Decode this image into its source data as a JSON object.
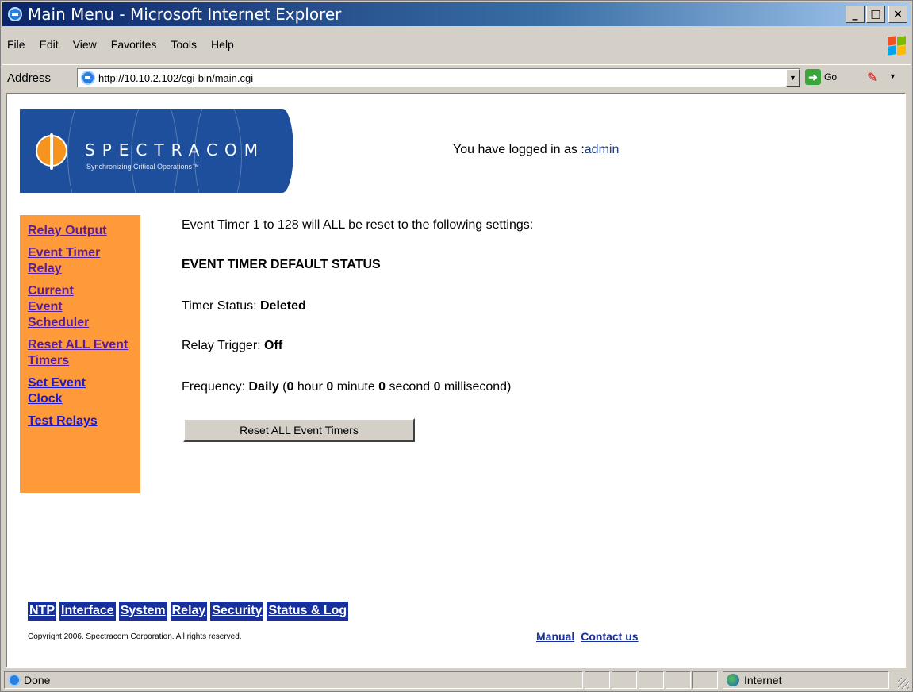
{
  "window": {
    "title": "Main Menu - Microsoft Internet Explorer",
    "minimize": "_",
    "maximize": "□",
    "close": "×"
  },
  "menubar": {
    "items": [
      "File",
      "Edit",
      "View",
      "Favorites",
      "Tools",
      "Help"
    ]
  },
  "addressbar": {
    "label": "Address",
    "url": "http://10.10.2.102/cgi-bin/main.cgi",
    "go_label": "Go"
  },
  "header": {
    "logo_name": "SPECTRACOM",
    "logo_tagline": "Synchronizing Critical Operations™",
    "login_prefix": "You have logged in as :",
    "login_user": "admin"
  },
  "sidemenu": {
    "items": [
      "Relay Output",
      "Event Timer Relay",
      "Current Event Scheduler",
      "Reset ALL Event Timers",
      "Set Event Clock",
      "Test Relays"
    ]
  },
  "main": {
    "intro": "Event Timer 1 to 128 will ALL be reset to the following settings:",
    "heading": "EVENT TIMER DEFAULT STATUS",
    "timer_status_label": "Timer Status: ",
    "timer_status_value": "Deleted",
    "relay_trigger_label": "Relay Trigger: ",
    "relay_trigger_value": "Off",
    "frequency_label": "Frequency: ",
    "frequency_value": "Daily",
    "freq_hour": "0",
    "freq_minute": "0",
    "freq_second": "0",
    "freq_millisecond": "0",
    "hour_unit": " hour ",
    "minute_unit": " minute ",
    "second_unit": " second ",
    "millisecond_unit": " millisecond)",
    "reset_button": "Reset ALL Event Timers"
  },
  "bottomnav": {
    "items": [
      "NTP",
      "Interface",
      "System",
      "Relay",
      "Security",
      "Status & Log"
    ]
  },
  "footer": {
    "copyright": "Copyright 2006. Spectracom Corporation. All rights reserved.",
    "manual": "Manual",
    "contact": "Contact us"
  },
  "statusbar": {
    "text": "Done",
    "zone": "Internet"
  }
}
